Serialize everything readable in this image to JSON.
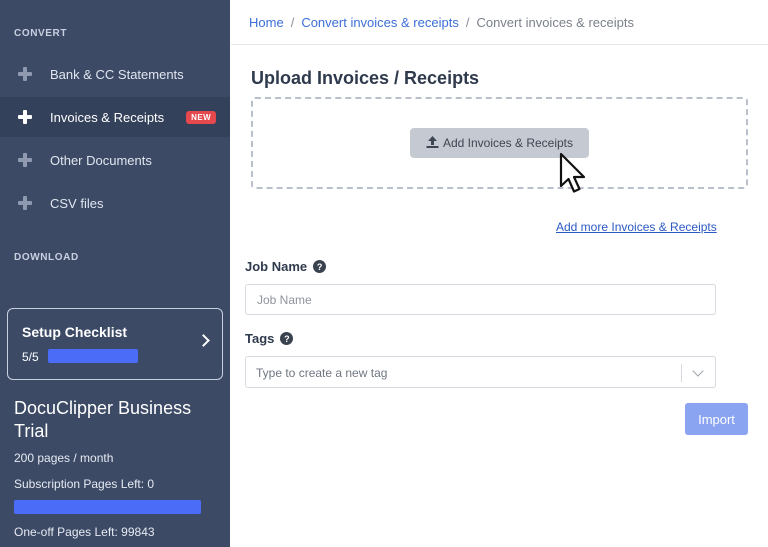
{
  "sidebar": {
    "convert_title": "CONVERT",
    "download_title": "DOWNLOAD",
    "items": [
      {
        "label": "Bank & CC Statements",
        "icon": "plus-icon"
      },
      {
        "label": "Invoices & Receipts",
        "icon": "plus-icon",
        "badge": "NEW",
        "active": true
      },
      {
        "label": "Other Documents",
        "icon": "plus-icon"
      },
      {
        "label": "CSV files",
        "icon": "plus-icon"
      }
    ],
    "checklist": {
      "title": "Setup Checklist",
      "progress": "5/5",
      "fraction": 1.0
    },
    "plan": {
      "name": "DocuClipper Business Trial",
      "pages_per_month": "200 pages / month",
      "subscription_left": "Subscription Pages Left: 0",
      "subscription_fraction": 1.0,
      "oneoff_left": "One-off Pages Left: 99843"
    }
  },
  "breadcrumb": {
    "home": "Home",
    "sep": "/",
    "parent": "Convert invoices & receipts",
    "current": "Convert invoices & receipts"
  },
  "main": {
    "title": "Upload Invoices / Receipts",
    "add_button": "Add Invoices & Receipts",
    "add_more_link": "Add more Invoices & Receipts",
    "job_name_label": "Job Name",
    "job_name_placeholder": "Job Name",
    "tags_label": "Tags",
    "tags_placeholder": "Type to create a new tag",
    "help_glyph": "?",
    "import_button": "Import"
  },
  "colors": {
    "sidebar_bg": "#3c4a66",
    "accent": "#4a6cf7",
    "badge_new": "#e5484d",
    "link": "#3b6fd8",
    "import_disabled": "#8aa4f2"
  }
}
